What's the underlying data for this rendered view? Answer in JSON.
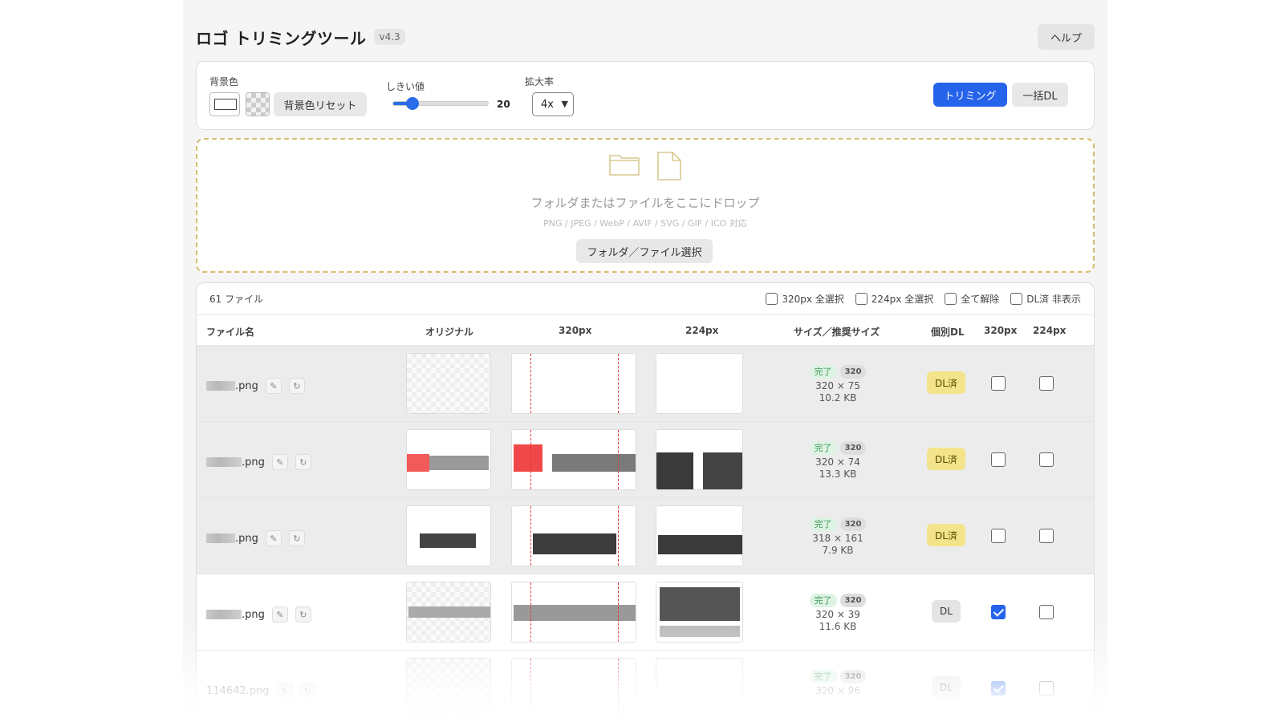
{
  "header": {
    "title": "ロゴ トリミングツール",
    "version": "v4.3",
    "help_label": "ヘルプ"
  },
  "toolbar": {
    "bg_label": "背景色",
    "bg_reset_label": "背景色リセット",
    "threshold_label": "しきい値",
    "threshold_value": "20",
    "threshold_fraction": 0.2,
    "zoom_label": "拡大率",
    "zoom_value": "4x",
    "trim_label": "トリミング",
    "dl_all_label": "一括DL"
  },
  "dropzone": {
    "folder_icon": "folder-icon",
    "file_icon": "file-icon",
    "main_text": "フォルダまたはファイルをここにドロップ",
    "sub_text": "PNG / JPEG / WebP / AVIF / SVG / GIF / ICO 対応",
    "select_label": "フォルダ／ファイル選択"
  },
  "list": {
    "count": "61 ファイル",
    "select_320": "320px 全選択",
    "select_224": "224px 全選択",
    "clear_all": "全て解除",
    "hide_dl": "DL済 非表示",
    "columns": [
      "ファイル名",
      "オリジナル",
      "320px",
      "224px",
      "サイズ／推奨サイズ",
      "個別DL",
      "320px",
      "224px"
    ],
    "rows": [
      {
        "ext": ".png",
        "status": "完了",
        "rec": "320",
        "dims": "320 × 75",
        "size": "10.2 KB",
        "dl": "DL済",
        "cb320": false,
        "cb224": false
      },
      {
        "ext": ".png",
        "status": "完了",
        "rec": "320",
        "dims": "320 × 74",
        "size": "13.3 KB",
        "dl": "DL済",
        "cb320": false,
        "cb224": false
      },
      {
        "ext": ".png",
        "status": "完了",
        "rec": "320",
        "dims": "318 × 161",
        "size": "7.9 KB",
        "dl": "DL済",
        "cb320": false,
        "cb224": false
      },
      {
        "ext": ".png",
        "status": "完了",
        "rec": "320",
        "dims": "320 × 39",
        "size": "11.6 KB",
        "dl": "DL",
        "cb320": true,
        "cb224": false
      },
      {
        "ext": "114642.png",
        "status": "完了",
        "rec": "320",
        "dims": "320 × 96",
        "size": "",
        "dl": "DL",
        "cb320": true,
        "cb224": false
      }
    ]
  },
  "colors": {
    "accent": "#2563eb",
    "dropzone_border": "#d4bd6e",
    "dl_done": "#f3e38a",
    "status_done": "#3a9a55"
  }
}
